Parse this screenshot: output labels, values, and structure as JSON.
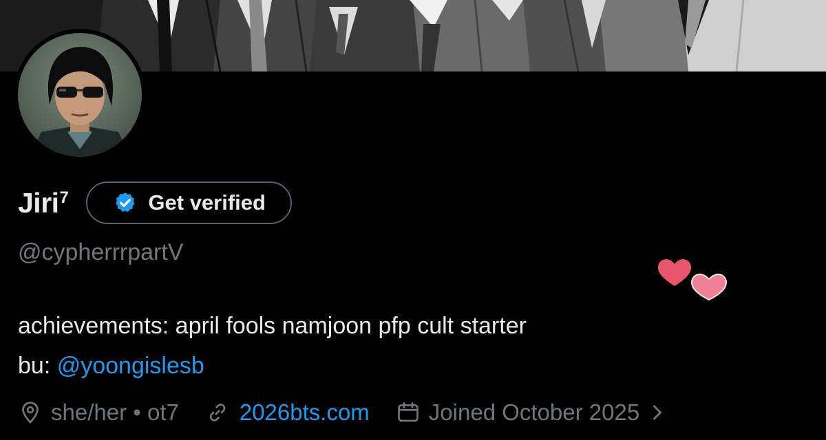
{
  "profile": {
    "display_name": "Jiri",
    "name_superscript": "7",
    "verify_label": "Get verified",
    "handle": "@cypherrrpartV",
    "bio": {
      "line1": "achievements: april fools namjoon pfp cult starter",
      "backup_prefix": "bu: ",
      "backup_mention": "@yoongislesb"
    },
    "meta": {
      "location": "she/her • ot7",
      "website": "2026bts.com",
      "joined": "Joined October 2025"
    }
  },
  "icons": {
    "verified": "verified-badge-icon",
    "location": "location-pin-icon",
    "link": "link-icon",
    "calendar": "calendar-icon",
    "chevron": "chevron-right-icon",
    "hearts": "two-hearts-emoji"
  },
  "colors": {
    "background": "#000000",
    "text_primary": "#e7e9ea",
    "text_secondary": "#71767b",
    "accent": "#1d9bf0",
    "heart": "#e8546b"
  }
}
